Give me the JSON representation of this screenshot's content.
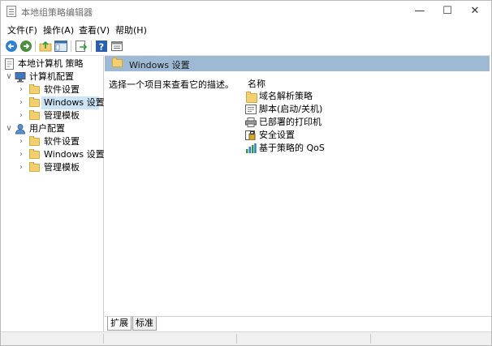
{
  "window": {
    "title": "本地组策略编辑器",
    "minimize": "—",
    "maximize": "☐",
    "close": "✕"
  },
  "menu": [
    "文件(F)",
    "操作(A)",
    "查看(V)",
    "帮助(H)"
  ],
  "toolbar": {
    "icons": [
      "back-arrow-icon",
      "forward-arrow-icon",
      "up-folder-icon",
      "show-hide-tree-icon",
      "export-list-icon",
      "help-icon",
      "properties-icon"
    ]
  },
  "tree": {
    "root": "本地计算机 策略",
    "computer_config": "计算机配置",
    "computer_children": [
      "软件设置",
      "Windows 设置",
      "管理模板"
    ],
    "user_config": "用户配置",
    "user_children": [
      "软件设置",
      "Windows 设置",
      "管理模板"
    ],
    "selected": "Windows 设置"
  },
  "right": {
    "header_title": "Windows 设置",
    "description": "选择一个项目来查看它的描述。",
    "column_name": "名称",
    "items": [
      {
        "label": "域名解析策略",
        "icon": "folder-icon"
      },
      {
        "label": "脚本(启动/关机)",
        "icon": "script-icon"
      },
      {
        "label": "已部署的打印机",
        "icon": "printer-icon"
      },
      {
        "label": "安全设置",
        "icon": "security-icon"
      },
      {
        "label": "基于策略的 QoS",
        "icon": "qos-chart-icon"
      }
    ]
  },
  "tabs": [
    "扩展",
    "标准"
  ],
  "colors": {
    "header_bar": "#9db9d4",
    "selection": "#cce4f7",
    "folder": "#f2cf70"
  }
}
